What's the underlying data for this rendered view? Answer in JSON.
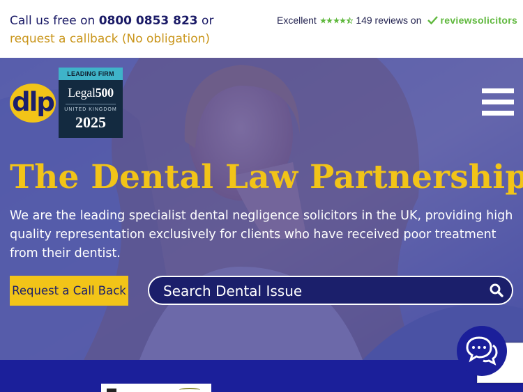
{
  "topbar": {
    "call_prefix": "Call us free on",
    "phone": "0800 0853 823",
    "or_text": "or",
    "callback_link": "request a callback (No obligation)"
  },
  "reviews": {
    "rating_text": "Excellent",
    "rating_value": 4.5,
    "count_text": "149 reviews on",
    "brand": "reviewsolicitors",
    "brand_color": "#5fb83d"
  },
  "hero": {
    "logo_text": "dlp",
    "badge": {
      "ribbon": "LEADING FIRM",
      "name_regular": "Legal",
      "name_bold": "500",
      "region": "UNITED KINGDOM",
      "year": "2025"
    },
    "title": "The Dental Law Partnership",
    "description": "We are the leading specialist dental negligence solicitors in the UK, providing high quality representation exclusively for clients who have received poor treatment from their dentist.",
    "callback_button": "Request a Call Back",
    "search_placeholder": "Search Dental Issue"
  },
  "icons": {
    "menu": "menu-icon",
    "search": "search-icon",
    "chat": "chat-icon",
    "check": "check-icon",
    "star": "star-icon"
  },
  "colors": {
    "brand_navy": "#1b1f6b",
    "brand_yellow": "#f2c418",
    "link_gold": "#c9951a",
    "review_green": "#5fb83d"
  }
}
